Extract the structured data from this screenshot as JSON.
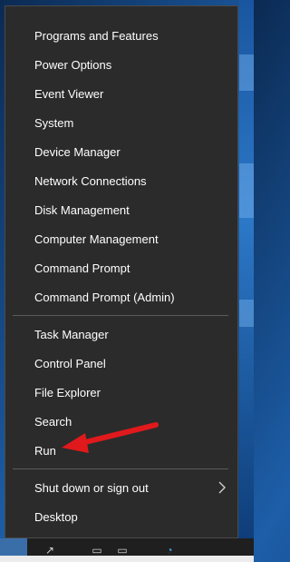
{
  "menu": {
    "group1": [
      {
        "key": "programs-and-features",
        "label": "Programs and Features"
      },
      {
        "key": "power-options",
        "label": "Power Options"
      },
      {
        "key": "event-viewer",
        "label": "Event Viewer"
      },
      {
        "key": "system",
        "label": "System"
      },
      {
        "key": "device-manager",
        "label": "Device Manager"
      },
      {
        "key": "network-connections",
        "label": "Network Connections"
      },
      {
        "key": "disk-management",
        "label": "Disk Management"
      },
      {
        "key": "computer-management",
        "label": "Computer Management"
      },
      {
        "key": "command-prompt",
        "label": "Command Prompt"
      },
      {
        "key": "command-prompt-admin",
        "label": "Command Prompt (Admin)"
      }
    ],
    "group2": [
      {
        "key": "task-manager",
        "label": "Task Manager"
      },
      {
        "key": "control-panel",
        "label": "Control Panel"
      },
      {
        "key": "file-explorer",
        "label": "File Explorer"
      },
      {
        "key": "search",
        "label": "Search"
      },
      {
        "key": "run",
        "label": "Run"
      }
    ],
    "group3": [
      {
        "key": "shut-down-or-sign-out",
        "label": "Shut down or sign out",
        "submenu": true
      },
      {
        "key": "desktop",
        "label": "Desktop"
      }
    ]
  },
  "annotation": {
    "arrow_icon": "red-arrow-icon",
    "color": "#e0191c"
  },
  "colors": {
    "menu_bg": "#2b2b2b",
    "menu_text": "#ffffff",
    "separator": "#5a5a5a"
  }
}
